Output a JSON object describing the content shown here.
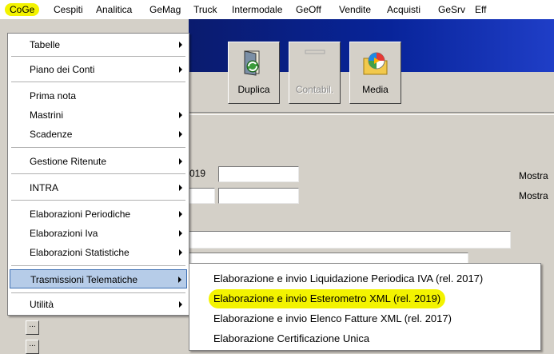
{
  "menubar": {
    "items": [
      "CoGe",
      "Cespiti",
      "Analitica",
      "GeMag",
      "Truck",
      "Intermodale",
      "GeOff",
      "Vendite",
      "Acquisti",
      "GeSrv",
      "Eff"
    ]
  },
  "toolbar": {
    "duplica_label": "Duplica",
    "contabil_label": "Contabil.",
    "media_label": "Media"
  },
  "form": {
    "field_partial_value": "019",
    "label_mostra_1": "Mostra",
    "label_mostra_2": "Mostra",
    "ellipsis": "..."
  },
  "main_menu": {
    "items": [
      {
        "label": "Tabelle",
        "submenu": true
      },
      {
        "label": "Piano dei Conti",
        "submenu": true
      },
      {
        "label": "Prima nota",
        "submenu": false
      },
      {
        "label": "Mastrini",
        "submenu": true
      },
      {
        "label": "Scadenze",
        "submenu": true
      },
      {
        "label": "Gestione Ritenute",
        "submenu": true
      },
      {
        "label": "INTRA",
        "submenu": true
      },
      {
        "label": "Elaborazioni Periodiche",
        "submenu": true
      },
      {
        "label": "Elaborazioni Iva",
        "submenu": true
      },
      {
        "label": "Elaborazioni Statistiche",
        "submenu": true
      },
      {
        "label": "Trasmissioni Telematiche",
        "submenu": true
      },
      {
        "label": "Utilità",
        "submenu": true
      }
    ],
    "selected": "Trasmissioni Telematiche"
  },
  "sub_menu": {
    "items": [
      "Elaborazione e invio Liquidazione Periodica IVA (rel. 2017)",
      "Elaborazione e invio Esterometro XML (rel. 2019)",
      "Elaborazione e invio Elenco Fatture XML (rel. 2017)",
      "Elaborazione Certificazione Unica"
    ],
    "highlighted": "Elaborazione e invio Esterometro XML (rel. 2019)"
  },
  "colors": {
    "highlight_yellow": "#f3f300",
    "selection_blue": "#b6cce8",
    "banner_blue": "#08249a"
  }
}
